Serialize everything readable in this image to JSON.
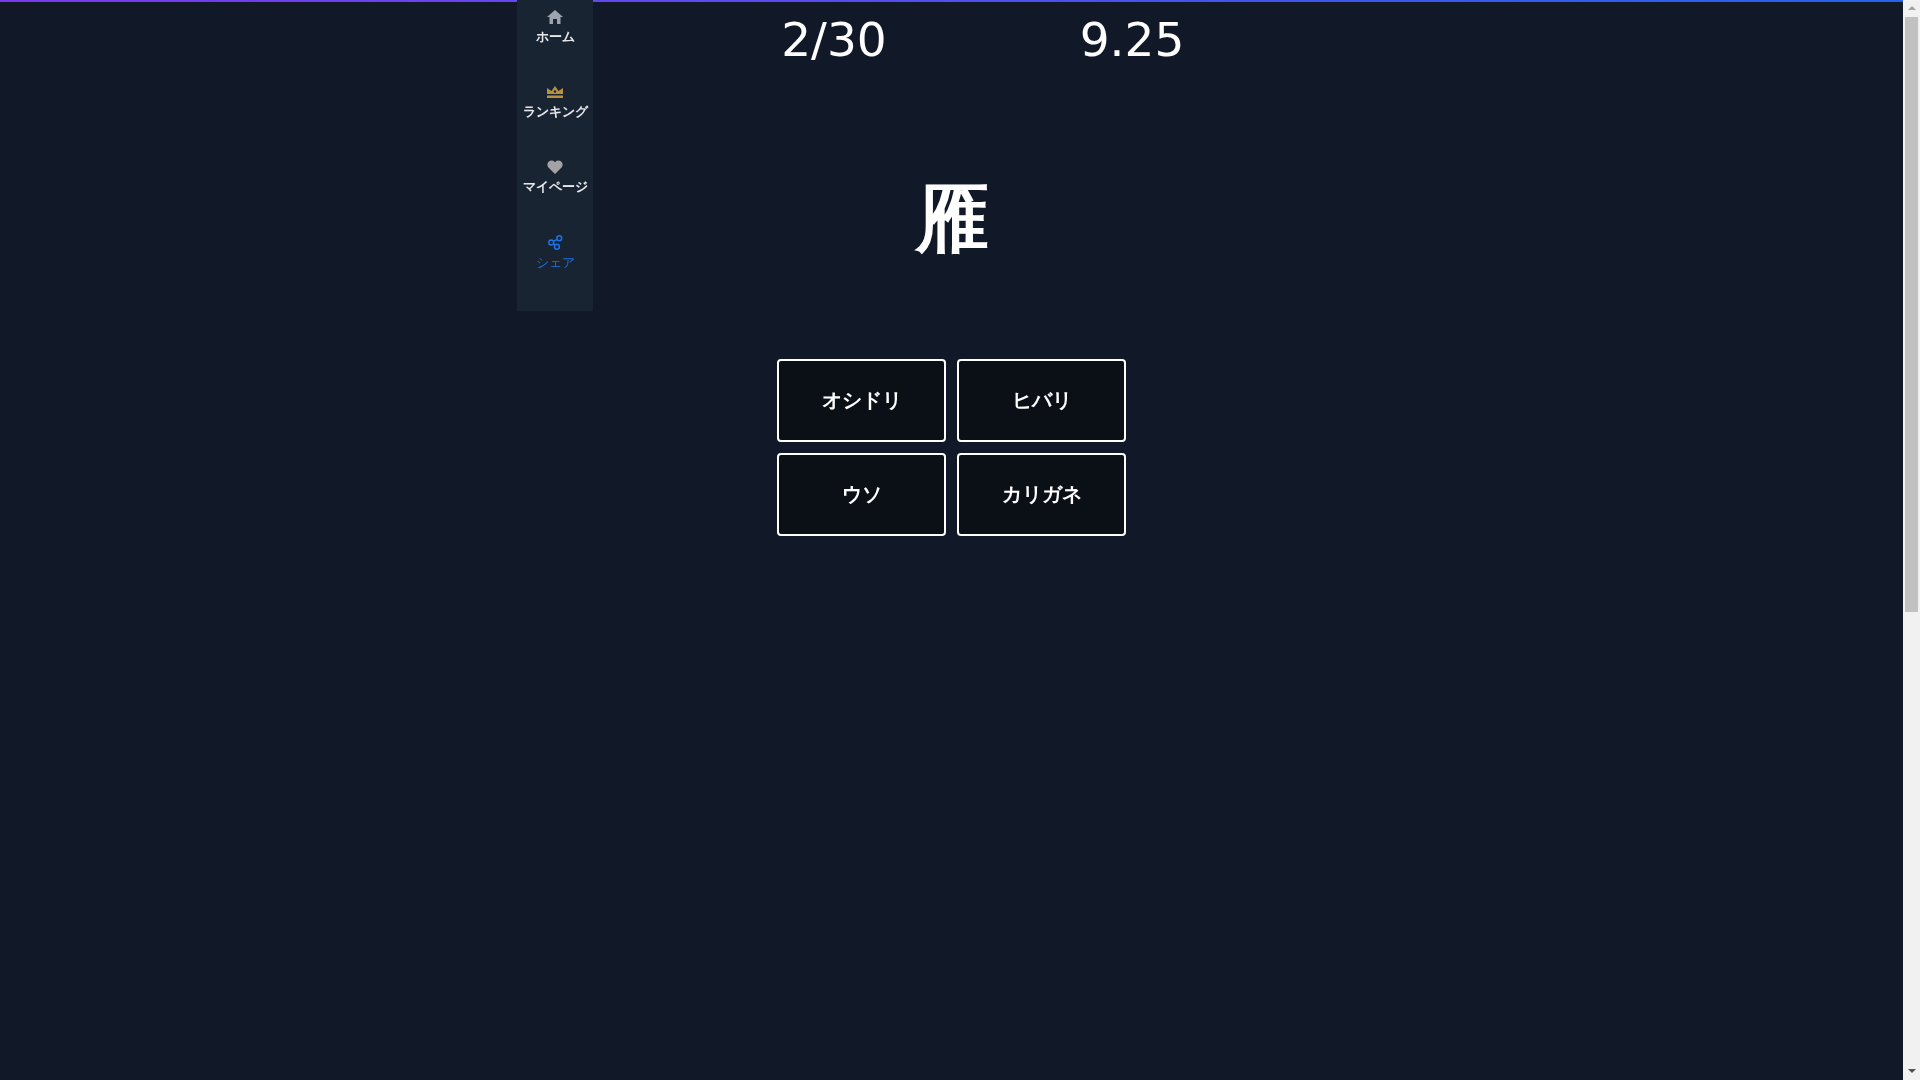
{
  "sidebar": {
    "items": [
      {
        "kind": "home",
        "label": "ホーム",
        "selected": false
      },
      {
        "kind": "crown",
        "label": "ランキング",
        "selected": false
      },
      {
        "kind": "heart",
        "label": "マイページ",
        "selected": false
      },
      {
        "kind": "share",
        "label": "シェア",
        "selected": true
      }
    ]
  },
  "header": {
    "counter": "2/30",
    "number": "9.25"
  },
  "question": {
    "kanji": "雁"
  },
  "choices": [
    {
      "label": "オシドリ",
      "selected": false
    },
    {
      "label": "ヒバリ",
      "selected": false
    },
    {
      "label": "ウソ",
      "selected": false
    },
    {
      "label": "カリガネ",
      "selected": false
    }
  ]
}
